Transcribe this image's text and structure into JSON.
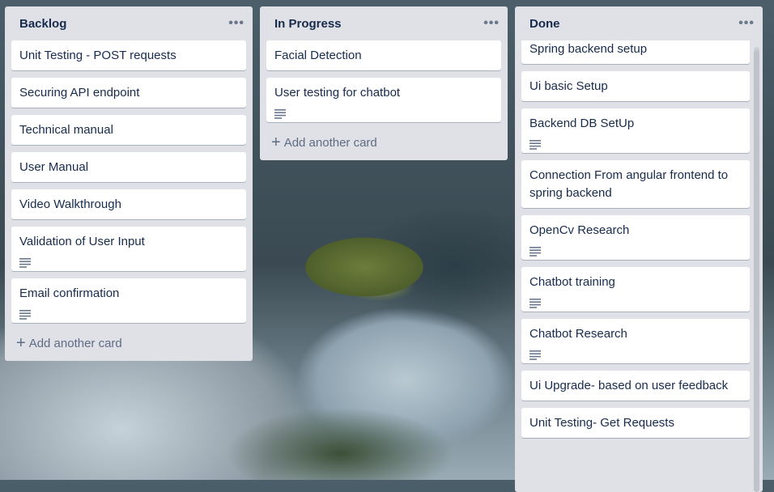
{
  "lists": [
    {
      "title": "Backlog",
      "menu": "•••",
      "cards": [
        {
          "text": "Unit Testing - POST requests",
          "has_description": false
        },
        {
          "text": "Securing API endpoint",
          "has_description": false
        },
        {
          "text": "Technical manual",
          "has_description": false
        },
        {
          "text": "User Manual",
          "has_description": false
        },
        {
          "text": "Video Walkthrough",
          "has_description": false
        },
        {
          "text": "Validation of User Input",
          "has_description": true
        },
        {
          "text": "Email confirmation",
          "has_description": true
        }
      ],
      "add_card": "Add another card"
    },
    {
      "title": "In Progress",
      "menu": "•••",
      "cards": [
        {
          "text": "Facial Detection",
          "has_description": false
        },
        {
          "text": "User testing for chatbot",
          "has_description": true
        }
      ],
      "add_card": "Add another card"
    },
    {
      "title": "Done",
      "menu": "•••",
      "cards": [
        {
          "text": "Spring backend setup",
          "has_description": false
        },
        {
          "text": "Ui basic Setup",
          "has_description": false
        },
        {
          "text": "Backend DB SetUp",
          "has_description": true
        },
        {
          "text": "Connection From angular frontend to spring backend",
          "has_description": false
        },
        {
          "text": "OpenCv Research",
          "has_description": true
        },
        {
          "text": "Chatbot training",
          "has_description": true
        },
        {
          "text": "Chatbot Research",
          "has_description": true
        },
        {
          "text": "Ui Upgrade- based on user feedback",
          "has_description": false
        },
        {
          "text": "Unit Testing- Get Requests",
          "has_description": false
        }
      ]
    }
  ],
  "icons": {
    "description": "description-icon",
    "add": "plus-icon",
    "menu": "more-icon"
  },
  "colors": {
    "list_bg": "#dfe1e6",
    "card_bg": "#ffffff",
    "text": "#172b4d",
    "muted": "#5e6c84"
  }
}
